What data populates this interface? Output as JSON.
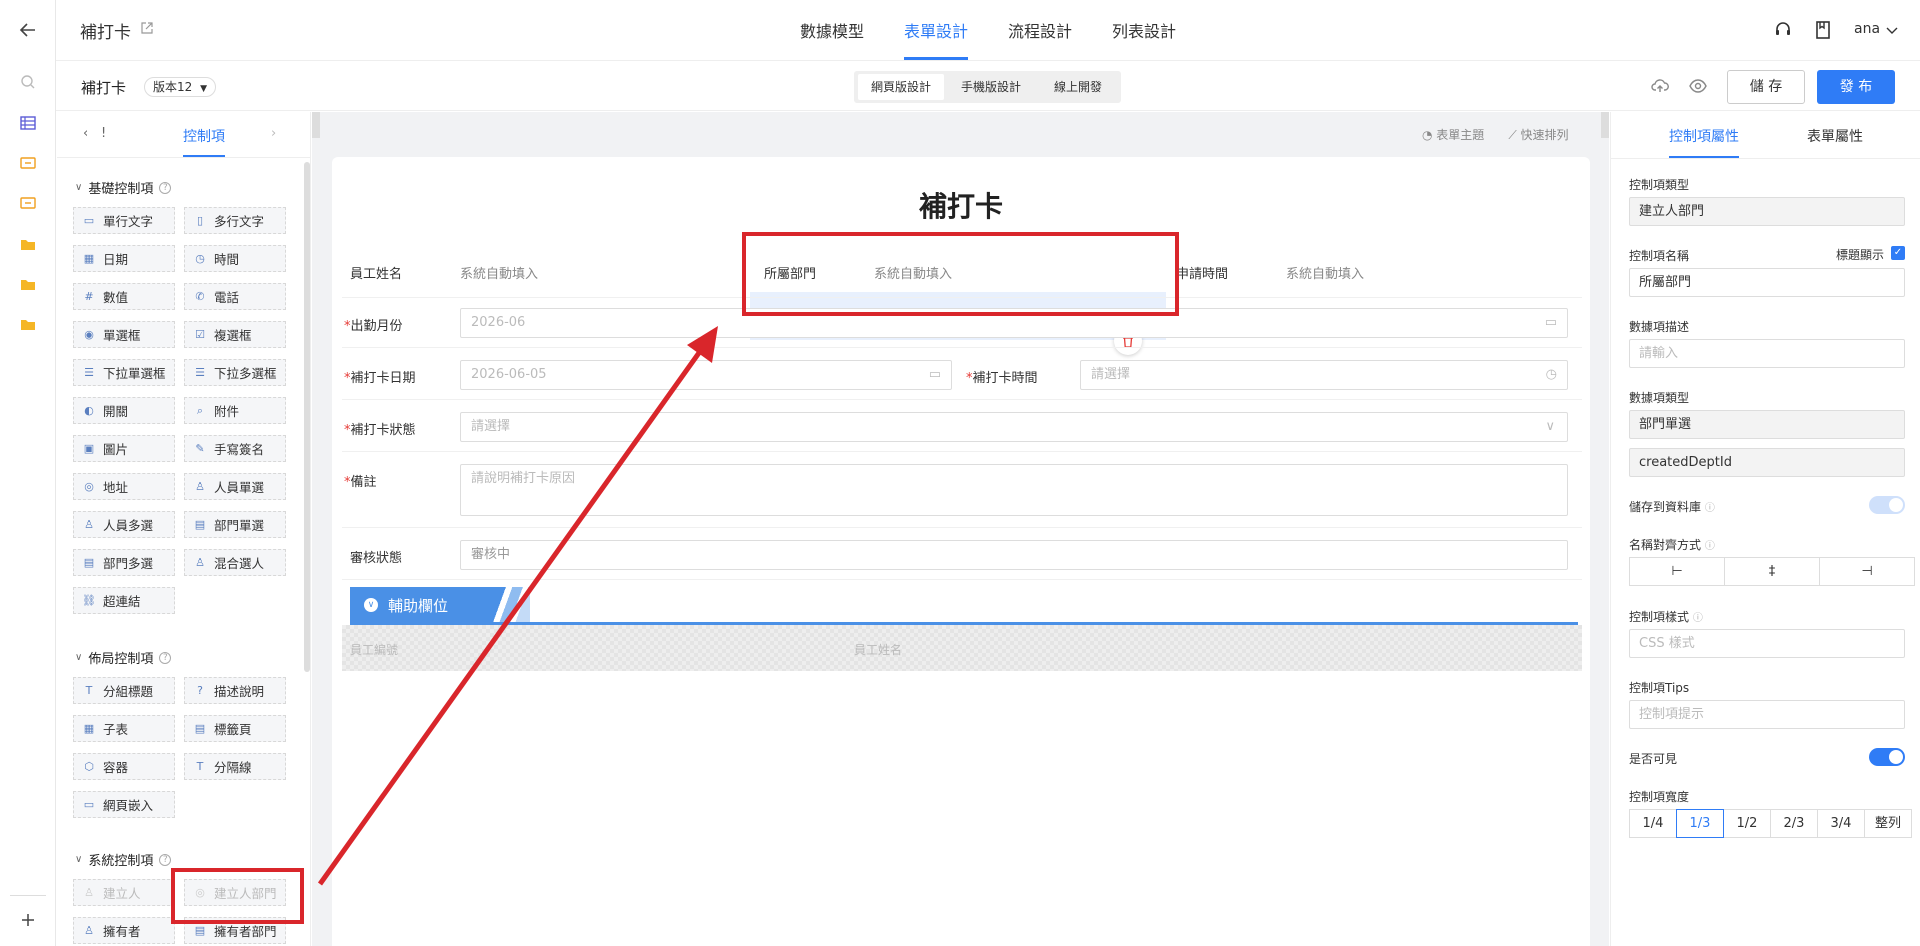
{
  "header": {
    "app_title": "補打卡",
    "tabs": [
      "數據模型",
      "表單設計",
      "流程設計",
      "列表設計"
    ],
    "user": "ana"
  },
  "subheader": {
    "form_name": "補打卡",
    "version": "版本12",
    "segments": [
      "網頁版設計",
      "手機版設計",
      "線上開發"
    ],
    "save": "儲 存",
    "publish": "發 布"
  },
  "left_panel": {
    "back": "!",
    "tab": "控制項",
    "sections": [
      {
        "title": "基礎控制項",
        "items": [
          "單行文字",
          "多行文字",
          "日期",
          "時間",
          "數值",
          "電話",
          "單選框",
          "複選框",
          "下拉單選框",
          "下拉多選框",
          "開關",
          "附件",
          "圖片",
          "手寫簽名",
          "地址",
          "人員單選",
          "人員多選",
          "部門單選",
          "部門多選",
          "混合選人",
          "超連結"
        ]
      },
      {
        "title": "佈局控制項",
        "items": [
          "分組標題",
          "描述說明",
          "子表",
          "標籤頁",
          "容器",
          "分隔線",
          "網頁嵌入"
        ]
      },
      {
        "title": "系統控制項",
        "items": [
          "建立人",
          "建立人部門",
          "擁有者",
          "擁有者部門"
        ]
      }
    ]
  },
  "canvas": {
    "tools": [
      "表單主題",
      "快速排列"
    ],
    "title": "補打卡",
    "auto_fill": "系統自動填入",
    "fields": {
      "emp_name": "員工姓名",
      "dept": "所屬部門",
      "apply_time": "申請時間",
      "month": "出勤月份",
      "month_value": "2026-06",
      "date": "補打卡日期",
      "date_value": "2026-06-05",
      "time": "補打卡時間",
      "time_ph": "請選擇",
      "status": "補打卡狀態",
      "status_ph": "請選擇",
      "remark": "備註",
      "remark_ph": "請說明補打卡原因",
      "review": "審核狀態",
      "review_value": "審核中"
    },
    "aux": {
      "title": "輔助欄位",
      "emp_no": "員工編號",
      "emp_name": "員工姓名"
    }
  },
  "right_panel": {
    "tabs": [
      "控制項屬性",
      "表單屬性"
    ],
    "type_label": "控制項類型",
    "type_value": "建立人部門",
    "name_label": "控制項名稱",
    "show_title": "標題顯示",
    "name_value": "所屬部門",
    "desc_label": "數據項描述",
    "desc_ph": "請輸入",
    "data_type_label": "數據項類型",
    "data_type_value": "部門單選",
    "field_id": "createdDeptId",
    "save_db": "儲存到資料庫",
    "align_label": "名稱對齊方式",
    "style_label": "控制項樣式",
    "style_ph": "CSS 樣式",
    "tips_label": "控制項Tips",
    "tips_ph": "控制項提示",
    "visible_label": "是否可見",
    "width_label": "控制項寬度",
    "widths": [
      "1/4",
      "1/3",
      "1/2",
      "2/3",
      "3/4",
      "整列"
    ],
    "active_width": "1/3"
  },
  "colors": {
    "accent": "#2f7cf6",
    "annotation": "#d9262b",
    "selection": "#e8f0fd"
  }
}
